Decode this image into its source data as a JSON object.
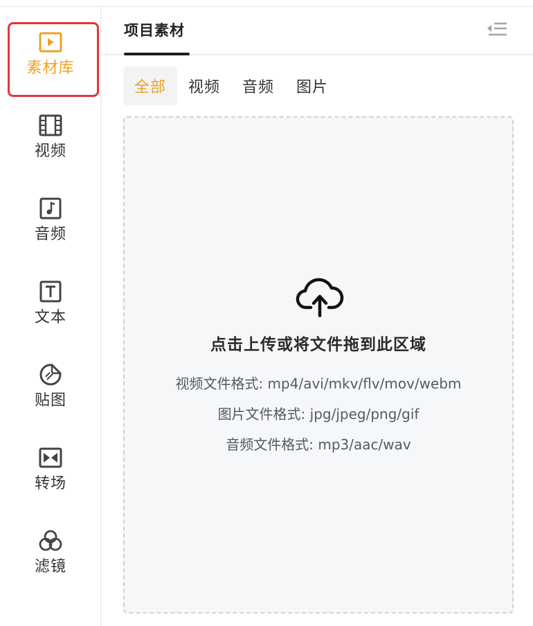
{
  "sidebar": {
    "items": [
      {
        "label": "素材库",
        "icon": "play-square-icon",
        "active": true
      },
      {
        "label": "视频",
        "icon": "film-icon",
        "active": false
      },
      {
        "label": "音频",
        "icon": "music-note-icon",
        "active": false
      },
      {
        "label": "文本",
        "icon": "text-t-icon",
        "active": false
      },
      {
        "label": "贴图",
        "icon": "sticker-icon",
        "active": false
      },
      {
        "label": "转场",
        "icon": "transition-icon",
        "active": false
      },
      {
        "label": "滤镜",
        "icon": "filter-circles-icon",
        "active": false
      }
    ]
  },
  "header": {
    "title": "项目素材",
    "collapse_icon": "collapse-panel-icon"
  },
  "tabs": [
    {
      "label": "全部",
      "active": true
    },
    {
      "label": "视频",
      "active": false
    },
    {
      "label": "音频",
      "active": false
    },
    {
      "label": "图片",
      "active": false
    }
  ],
  "dropzone": {
    "icon": "cloud-upload-icon",
    "title": "点击上传或将文件拖到此区域",
    "video_formats": "视频文件格式: mp4/avi/mkv/flv/mov/webm",
    "image_formats": "图片文件格式: jpg/jpeg/png/gif",
    "audio_formats": "音频文件格式: mp3/aac/wav"
  },
  "colors": {
    "accent": "#f0a020",
    "highlight_outline": "#e5333a",
    "text": "#333333",
    "icon": "#444444"
  }
}
